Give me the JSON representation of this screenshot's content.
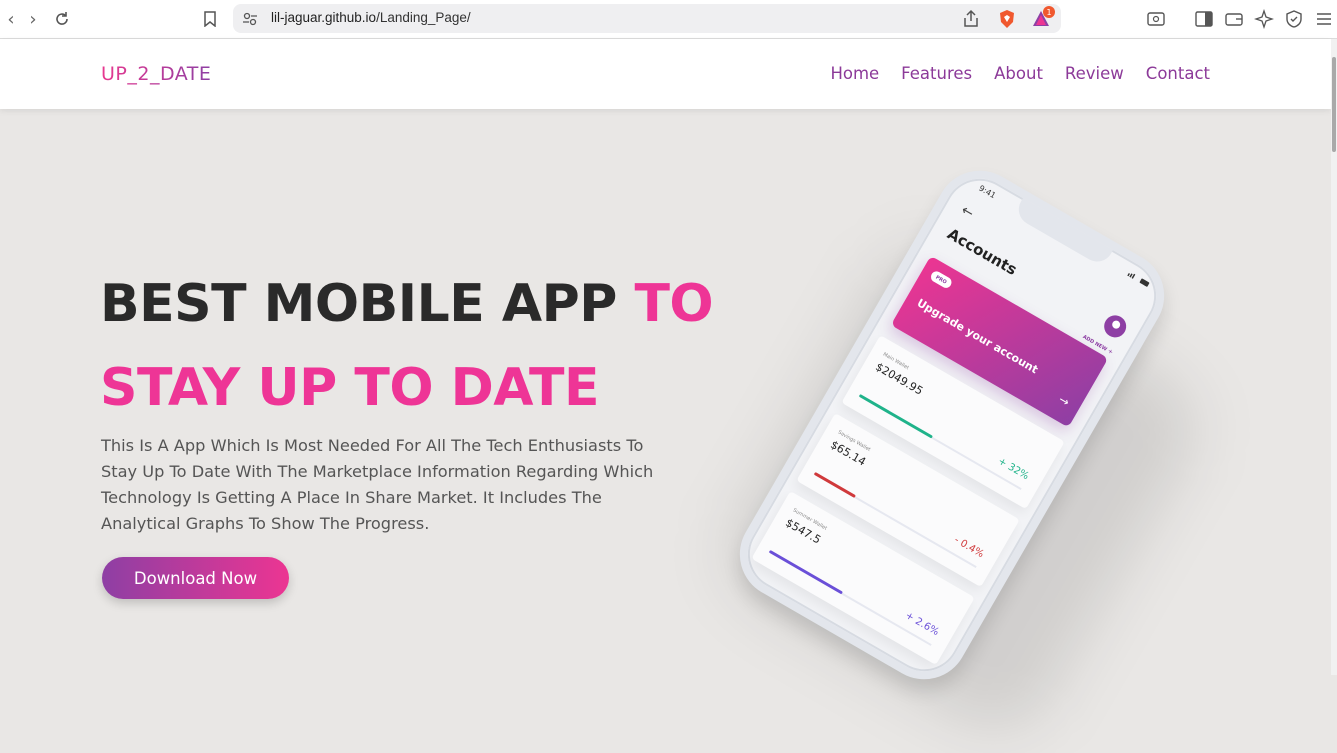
{
  "browser": {
    "url_domain": "lil-jaguar.github.io",
    "url_path": "/Landing_Page/",
    "brave_badge_count": "1"
  },
  "site": {
    "logo": "UP_2_DATE",
    "nav": [
      "Home",
      "Features",
      "About",
      "Review",
      "Contact"
    ]
  },
  "hero": {
    "title_part1": "BEST MOBILE APP ",
    "title_part2": "TO",
    "title_line2": "STAY UP TO DATE",
    "description": "This Is A App Which Is Most Needed For All The Tech Enthusiasts To Stay Up To Date With The Marketplace Information Regarding Which Technology Is Getting A Place In Share Market. It Includes The Analytical Graphs To Show The Progress.",
    "cta": "Download Now"
  },
  "phone": {
    "time": "9:41",
    "screen_title": "Accounts",
    "add_new": "ADD NEW",
    "pro_badge": "PRO",
    "upgrade_text": "Upgrade your account",
    "wallets": [
      {
        "label": "Main Wallet",
        "amount": "$2049.95",
        "change": "+ 32%",
        "color": "#1fb38a",
        "fill_fraction": 0.45
      },
      {
        "label": "Savings Wallet",
        "amount": "$65.14",
        "change": "- 0.4%",
        "color": "#d0393b",
        "fill_fraction": 0.25
      },
      {
        "label": "Summer Wallet",
        "amount": "$547.5",
        "change": "+ 2.6%",
        "color": "#6a4fd8",
        "fill_fraction": 0.45
      }
    ]
  },
  "colors": {
    "brand_pink": "#ee3596",
    "brand_purple": "#8e3fa4",
    "nav_text": "#8c3a99",
    "background": "#e9e7e5"
  }
}
